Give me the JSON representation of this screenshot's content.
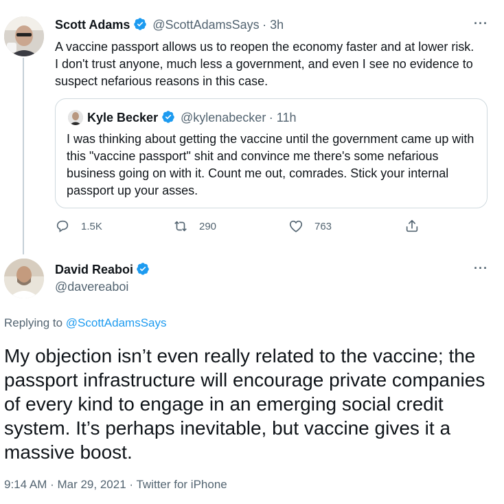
{
  "tweet1": {
    "name": "Scott Adams",
    "handle": "@ScottAdamsSays",
    "time": "3h",
    "more": "···",
    "text": "A vaccine passport allows us to  reopen the economy faster and at lower risk. I don't trust anyone, much less a government, and even I see no evidence to suspect nefarious reasons in this case.",
    "quote": {
      "name": "Kyle Becker",
      "handle": "@kylenabecker",
      "time": "11h",
      "text": "I was thinking about getting the vaccine until the government came up with this \"vaccine passport\" shit and convince me there's some nefarious business going on with it. Count me out, comrades. Stick your internal passport up your asses."
    },
    "actions": {
      "replies": "1.5K",
      "retweets": "290",
      "likes": "763"
    }
  },
  "tweet2": {
    "name": "David Reaboi",
    "handle": "@davereaboi",
    "more": "···",
    "replying_prefix": "Replying to ",
    "replying_to": "@ScottAdamsSays",
    "text": "My objection isn’t even really related to the vaccine; the passport infrastructure will encourage private companies of every  kind to engage in an emerging social credit system. It’s perhaps inevitable, but vaccine gives it a massive boost.",
    "timestamp": "9:14 AM · Mar 29, 2021 · Twitter for iPhone"
  },
  "colors": {
    "verified": "#1d9bf0",
    "secondary_text": "#536471",
    "border": "#cfd9de"
  }
}
